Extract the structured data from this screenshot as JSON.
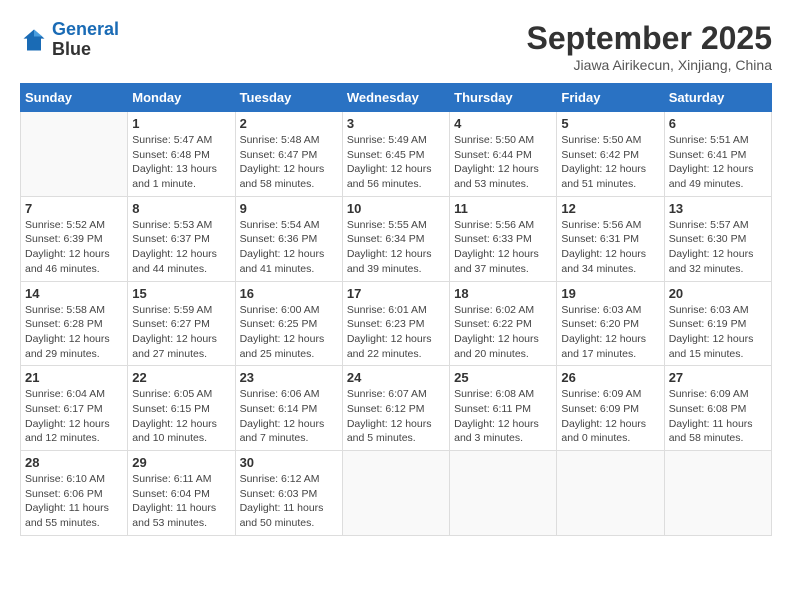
{
  "header": {
    "logo_line1": "General",
    "logo_line2": "Blue",
    "month": "September 2025",
    "location": "Jiawa Airikecun, Xinjiang, China"
  },
  "weekdays": [
    "Sunday",
    "Monday",
    "Tuesday",
    "Wednesday",
    "Thursday",
    "Friday",
    "Saturday"
  ],
  "weeks": [
    [
      {
        "day": "",
        "sunrise": "",
        "sunset": "",
        "daylight": ""
      },
      {
        "day": "1",
        "sunrise": "Sunrise: 5:47 AM",
        "sunset": "Sunset: 6:48 PM",
        "daylight": "Daylight: 13 hours and 1 minute."
      },
      {
        "day": "2",
        "sunrise": "Sunrise: 5:48 AM",
        "sunset": "Sunset: 6:47 PM",
        "daylight": "Daylight: 12 hours and 58 minutes."
      },
      {
        "day": "3",
        "sunrise": "Sunrise: 5:49 AM",
        "sunset": "Sunset: 6:45 PM",
        "daylight": "Daylight: 12 hours and 56 minutes."
      },
      {
        "day": "4",
        "sunrise": "Sunrise: 5:50 AM",
        "sunset": "Sunset: 6:44 PM",
        "daylight": "Daylight: 12 hours and 53 minutes."
      },
      {
        "day": "5",
        "sunrise": "Sunrise: 5:50 AM",
        "sunset": "Sunset: 6:42 PM",
        "daylight": "Daylight: 12 hours and 51 minutes."
      },
      {
        "day": "6",
        "sunrise": "Sunrise: 5:51 AM",
        "sunset": "Sunset: 6:41 PM",
        "daylight": "Daylight: 12 hours and 49 minutes."
      }
    ],
    [
      {
        "day": "7",
        "sunrise": "Sunrise: 5:52 AM",
        "sunset": "Sunset: 6:39 PM",
        "daylight": "Daylight: 12 hours and 46 minutes."
      },
      {
        "day": "8",
        "sunrise": "Sunrise: 5:53 AM",
        "sunset": "Sunset: 6:37 PM",
        "daylight": "Daylight: 12 hours and 44 minutes."
      },
      {
        "day": "9",
        "sunrise": "Sunrise: 5:54 AM",
        "sunset": "Sunset: 6:36 PM",
        "daylight": "Daylight: 12 hours and 41 minutes."
      },
      {
        "day": "10",
        "sunrise": "Sunrise: 5:55 AM",
        "sunset": "Sunset: 6:34 PM",
        "daylight": "Daylight: 12 hours and 39 minutes."
      },
      {
        "day": "11",
        "sunrise": "Sunrise: 5:56 AM",
        "sunset": "Sunset: 6:33 PM",
        "daylight": "Daylight: 12 hours and 37 minutes."
      },
      {
        "day": "12",
        "sunrise": "Sunrise: 5:56 AM",
        "sunset": "Sunset: 6:31 PM",
        "daylight": "Daylight: 12 hours and 34 minutes."
      },
      {
        "day": "13",
        "sunrise": "Sunrise: 5:57 AM",
        "sunset": "Sunset: 6:30 PM",
        "daylight": "Daylight: 12 hours and 32 minutes."
      }
    ],
    [
      {
        "day": "14",
        "sunrise": "Sunrise: 5:58 AM",
        "sunset": "Sunset: 6:28 PM",
        "daylight": "Daylight: 12 hours and 29 minutes."
      },
      {
        "day": "15",
        "sunrise": "Sunrise: 5:59 AM",
        "sunset": "Sunset: 6:27 PM",
        "daylight": "Daylight: 12 hours and 27 minutes."
      },
      {
        "day": "16",
        "sunrise": "Sunrise: 6:00 AM",
        "sunset": "Sunset: 6:25 PM",
        "daylight": "Daylight: 12 hours and 25 minutes."
      },
      {
        "day": "17",
        "sunrise": "Sunrise: 6:01 AM",
        "sunset": "Sunset: 6:23 PM",
        "daylight": "Daylight: 12 hours and 22 minutes."
      },
      {
        "day": "18",
        "sunrise": "Sunrise: 6:02 AM",
        "sunset": "Sunset: 6:22 PM",
        "daylight": "Daylight: 12 hours and 20 minutes."
      },
      {
        "day": "19",
        "sunrise": "Sunrise: 6:03 AM",
        "sunset": "Sunset: 6:20 PM",
        "daylight": "Daylight: 12 hours and 17 minutes."
      },
      {
        "day": "20",
        "sunrise": "Sunrise: 6:03 AM",
        "sunset": "Sunset: 6:19 PM",
        "daylight": "Daylight: 12 hours and 15 minutes."
      }
    ],
    [
      {
        "day": "21",
        "sunrise": "Sunrise: 6:04 AM",
        "sunset": "Sunset: 6:17 PM",
        "daylight": "Daylight: 12 hours and 12 minutes."
      },
      {
        "day": "22",
        "sunrise": "Sunrise: 6:05 AM",
        "sunset": "Sunset: 6:15 PM",
        "daylight": "Daylight: 12 hours and 10 minutes."
      },
      {
        "day": "23",
        "sunrise": "Sunrise: 6:06 AM",
        "sunset": "Sunset: 6:14 PM",
        "daylight": "Daylight: 12 hours and 7 minutes."
      },
      {
        "day": "24",
        "sunrise": "Sunrise: 6:07 AM",
        "sunset": "Sunset: 6:12 PM",
        "daylight": "Daylight: 12 hours and 5 minutes."
      },
      {
        "day": "25",
        "sunrise": "Sunrise: 6:08 AM",
        "sunset": "Sunset: 6:11 PM",
        "daylight": "Daylight: 12 hours and 3 minutes."
      },
      {
        "day": "26",
        "sunrise": "Sunrise: 6:09 AM",
        "sunset": "Sunset: 6:09 PM",
        "daylight": "Daylight: 12 hours and 0 minutes."
      },
      {
        "day": "27",
        "sunrise": "Sunrise: 6:09 AM",
        "sunset": "Sunset: 6:08 PM",
        "daylight": "Daylight: 11 hours and 58 minutes."
      }
    ],
    [
      {
        "day": "28",
        "sunrise": "Sunrise: 6:10 AM",
        "sunset": "Sunset: 6:06 PM",
        "daylight": "Daylight: 11 hours and 55 minutes."
      },
      {
        "day": "29",
        "sunrise": "Sunrise: 6:11 AM",
        "sunset": "Sunset: 6:04 PM",
        "daylight": "Daylight: 11 hours and 53 minutes."
      },
      {
        "day": "30",
        "sunrise": "Sunrise: 6:12 AM",
        "sunset": "Sunset: 6:03 PM",
        "daylight": "Daylight: 11 hours and 50 minutes."
      },
      {
        "day": "",
        "sunrise": "",
        "sunset": "",
        "daylight": ""
      },
      {
        "day": "",
        "sunrise": "",
        "sunset": "",
        "daylight": ""
      },
      {
        "day": "",
        "sunrise": "",
        "sunset": "",
        "daylight": ""
      },
      {
        "day": "",
        "sunrise": "",
        "sunset": "",
        "daylight": ""
      }
    ]
  ]
}
